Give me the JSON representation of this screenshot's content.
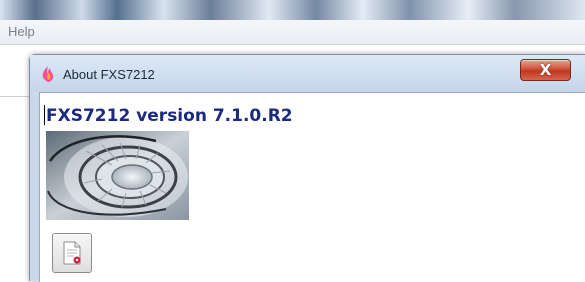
{
  "parent_window": {
    "menu": {
      "help_label": "Help"
    }
  },
  "dialog": {
    "title": "About FXS7212",
    "close_label": "X",
    "version_heading": "FXS7212 version 7.1.0.R2",
    "icons": {
      "app": "flame-icon",
      "close": "close-icon",
      "image": "spiral-staircase-image",
      "document": "document-icon"
    }
  },
  "colors": {
    "heading": "#1a2a80",
    "close_button": "#c1371f",
    "dialog_frame": "#c9d8ea"
  }
}
